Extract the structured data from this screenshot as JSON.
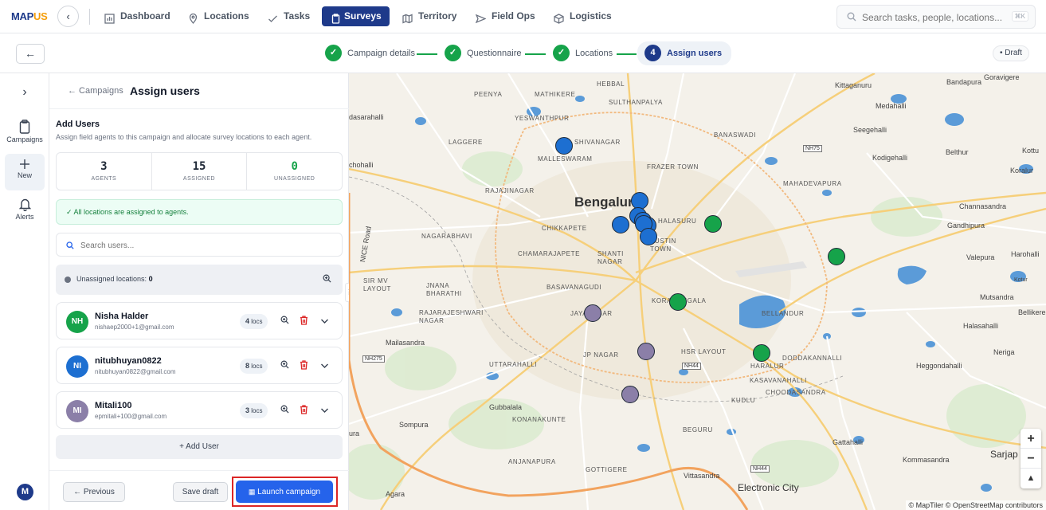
{
  "nav": {
    "logo_main": "MAP",
    "logo_accent": "US",
    "items": [
      {
        "label": "Dashboard",
        "icon": "bar-chart-icon"
      },
      {
        "label": "Locations",
        "icon": "map-pin-icon"
      },
      {
        "label": "Tasks",
        "icon": "check-icon"
      },
      {
        "label": "Surveys",
        "icon": "clipboard-icon",
        "active": true
      },
      {
        "label": "Territory",
        "icon": "map-icon"
      },
      {
        "label": "Field Ops",
        "icon": "send-icon"
      },
      {
        "label": "Logistics",
        "icon": "box-icon"
      }
    ],
    "search_placeholder": "Search tasks, people, locations...",
    "search_shortcut": "⌘K"
  },
  "stepper": {
    "steps": [
      {
        "label": "Campaign details",
        "state": "done",
        "mark": "✓"
      },
      {
        "label": "Questionnaire",
        "state": "done",
        "mark": "✓"
      },
      {
        "label": "Locations",
        "state": "done",
        "mark": "✓"
      },
      {
        "label": "Assign users",
        "state": "current",
        "mark": "4"
      }
    ],
    "status_badge": "• Draft"
  },
  "rail": {
    "items": [
      {
        "label": "Campaigns",
        "icon": "clipboard-icon"
      },
      {
        "label": "New",
        "icon": "plus-icon",
        "active": true
      },
      {
        "label": "Alerts",
        "icon": "bell-icon"
      }
    ],
    "user_initial": "M"
  },
  "panel": {
    "breadcrumb": "← Campaigns",
    "title": "Assign users",
    "section_title": "Add Users",
    "section_desc": "Assign field agents to this campaign and allocate survey locations to each agent.",
    "stats": [
      {
        "value": "3",
        "label": "AGENTS"
      },
      {
        "value": "15",
        "label": "ASSIGNED"
      },
      {
        "value": "0",
        "label": "UNASSIGNED"
      }
    ],
    "success_message": "✓ All locations are assigned to agents.",
    "search_placeholder": "Search users...",
    "unassigned_label": "Unassigned locations:",
    "unassigned_count": "0",
    "users": [
      {
        "initials": "NH",
        "name": "Nisha Halder",
        "email": "nishaep2000+1@gmail.com",
        "locs_count": "4",
        "locs_unit": "locs",
        "color": "#16a34a"
      },
      {
        "initials": "NI",
        "name": "nitubhuyan0822",
        "email": "nitubhuyan0822@gmail.com",
        "locs_count": "8",
        "locs_unit": "locs",
        "color": "#1d6fd1"
      },
      {
        "initials": "MI",
        "name": "Mitali100",
        "email": "epmitali+100@gmail.com",
        "locs_count": "3",
        "locs_unit": "locs",
        "color": "#8b7fa8"
      }
    ],
    "add_user": "+ Add User",
    "btn_previous": "← Previous",
    "btn_save_draft": "Save draft",
    "btn_launch": "Launch campaign"
  },
  "map": {
    "labels": {
      "peenya": "PEENYA",
      "mathikere": "MATHIKERE",
      "hebbal": "HEBBAL",
      "sultanpalya": "SULTHANPALYA",
      "kittaganuru": "Kittaganuru",
      "bandapura": "Bandapura",
      "goravigere": "Goravigere",
      "medahalli": "Medahalli",
      "yeswanthpur": "YESWANTHPUR",
      "dasarahalli": "dasarahalli",
      "laggere": "LAGGERE",
      "shivanagar": "SHIVANAGAR",
      "banaswadi": "BANASWADI",
      "seegehalli": "Seegehalli",
      "malleswaram": "MALLESWARAM",
      "frazer_town": "FRAZER TOWN",
      "kodigehalli": "Kodigehalli",
      "belthur": "Belthur",
      "korlur": "Koralur",
      "kottu": "Kottu",
      "chohalli": "chohalli",
      "rajajinagar": "RAJAJINAGAR",
      "mahadevapura": "MAHADEVAPURA",
      "bengaluru": "Bengaluru",
      "halasuru": "HALASURU",
      "channasandra": "Channasandra",
      "chikkapete": "CHIKKAPETE",
      "gandhipura": "Gandhipura",
      "nagarabhavi": "NAGARABHAVI",
      "austin_town": "AUSTIN TOWN",
      "valepura": "Valepura",
      "harohalli": "Harohalli",
      "chamarajapete": "CHAMARAJAPETE",
      "shanti_nagar": "SHANTI NAGAR",
      "nice_road": "NICE Road",
      "sir_mv_layout": "SIR MV LAYOUT",
      "basavanagudi": "BASAVANAGUDI",
      "mutsandra": "Mutsandra",
      "kotur": "Kotur",
      "jnana_bharathi": "JNANA BHARATHI",
      "koramangala": "KORAMANGALA",
      "bellikere": "Bellikere",
      "rajarajeshwari": "RAJARAJESHWARI NAGAR",
      "jayanagar": "JAYANAGAR",
      "bellandur": "BELLANDUR",
      "halasahalli": "Halasahalli",
      "mailasandra": "Mailasandra",
      "jp_nagar": "JP NAGAR",
      "hsr_layout": "HSR LAYOUT",
      "neriga": "Neriga",
      "uttarahalli": "UTTARAHALLI",
      "haralur": "HARALUR",
      "doddakannalli": "DODDAKANNALLI",
      "heggondahalli": "Heggondahalli",
      "kasavanahalli": "KASAVANAHALLI",
      "choodasandra": "CHOODASANDRA",
      "kudlu": "KUDLU",
      "gubbalala": "Gubbalala",
      "konanakunte": "KONANAKUNTE",
      "somapura": "Sompura",
      "beguru": "BEGURU",
      "gattahalli": "Gattahalli",
      "anjanapura": "ANJANAPURA",
      "kommasandra": "Kommasandra",
      "sarjapur": "Sarjap",
      "gottigere": "GOTTIGERE",
      "vittasandra": "Vittasandra",
      "electronic_city": "Electronic City",
      "agara": "Agara",
      "jura": "ura"
    },
    "shields": {
      "nh75": "NH75",
      "nh275": "NH275",
      "nh44a": "NH44",
      "nh44b": "NH44"
    },
    "markers": [
      {
        "agent": "nitubhuyan0822",
        "color": "#1d6fd1"
      },
      {
        "agent": "Nisha Halder",
        "color": "#16a34a"
      },
      {
        "agent": "Mitali100",
        "color": "#8b7fa8"
      }
    ],
    "zoom_in": "+",
    "zoom_out": "−",
    "north": "▲",
    "attribution": "© MapTiler © OpenStreetMap contributors"
  }
}
